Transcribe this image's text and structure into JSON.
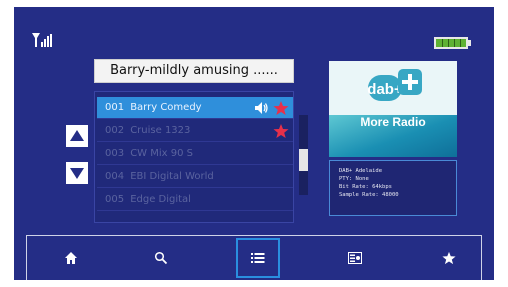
{
  "status": {
    "signal_icon": "signal-strength-icon",
    "battery_icon": "battery-full-icon",
    "battery_color": "#5fb233"
  },
  "now_playing": {
    "title": "Barry-mildly amusing ......"
  },
  "station_list": {
    "selected_index": 0,
    "items": [
      {
        "number": "001",
        "name": "Barry Comedy",
        "playing": true,
        "favorite": true
      },
      {
        "number": "002",
        "name": "Cruise 1323",
        "playing": false,
        "favorite": true
      },
      {
        "number": "003",
        "name": "CW Mix 90 S",
        "playing": false,
        "favorite": false
      },
      {
        "number": "004",
        "name": "EBI Digital World",
        "playing": false,
        "favorite": false
      },
      {
        "number": "005",
        "name": "Edge Digital",
        "playing": false,
        "favorite": false
      }
    ]
  },
  "logo": {
    "wordmark": "dab+",
    "caption": "More Radio"
  },
  "station_info": {
    "lines": [
      "DAB+ Adelaide",
      "PTY: None",
      "Bit Rate: 64kbps",
      "Sample Rate: 48000"
    ]
  },
  "toolbar": {
    "items": [
      {
        "icon": "home-icon",
        "selected": false
      },
      {
        "icon": "search-icon",
        "selected": false
      },
      {
        "icon": "list-icon",
        "selected": true
      },
      {
        "icon": "radio-info-icon",
        "selected": false
      },
      {
        "icon": "star-icon",
        "selected": false
      }
    ],
    "accent_color": "#2a8fe0"
  },
  "colors": {
    "screen_background": "#242d86",
    "selected_row": "#2f8fdb",
    "favorite_star": "#e8304a"
  }
}
